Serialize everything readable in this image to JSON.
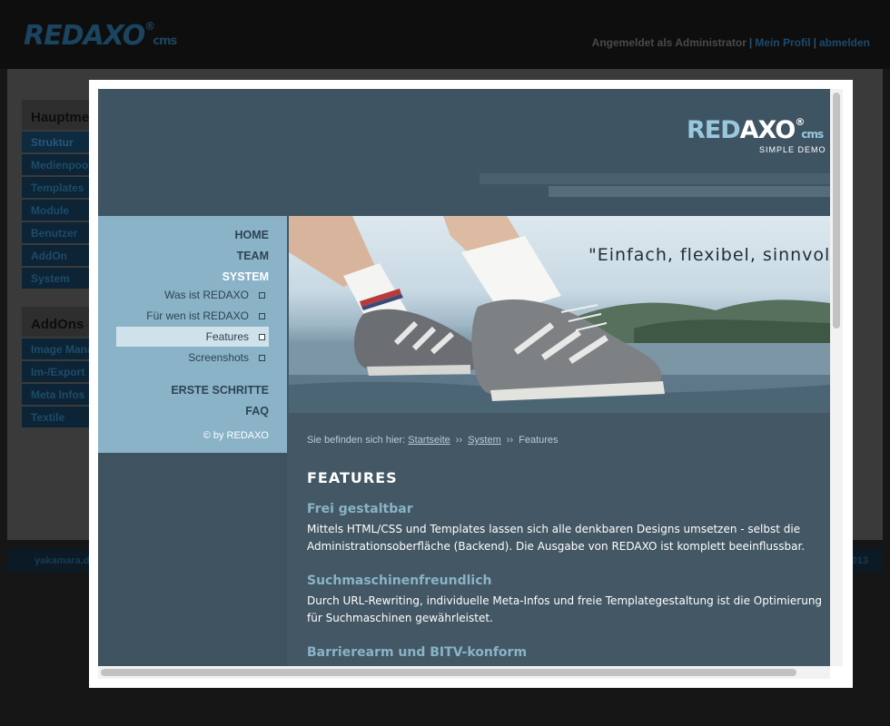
{
  "backend": {
    "logo": {
      "text": "REDAXO",
      "registered": "®",
      "suffix": "cms"
    },
    "login": {
      "text": "Angemeldet als Administrator",
      "profile_link": "Mein Profil",
      "logout_link": "abmelden",
      "separator": "|"
    },
    "main_menu": {
      "title": "Hauptme",
      "items": [
        "Struktur",
        "Medienpool",
        "Templates",
        "Module",
        "Benutzer",
        "AddOn",
        "System"
      ]
    },
    "addons_menu": {
      "title": "AddOns",
      "items": [
        "Image Mana",
        "Im-/Export",
        "Meta Infos",
        "Textile"
      ]
    },
    "footer": {
      "left": "yakamara.d",
      "right": "013"
    }
  },
  "site": {
    "logo": {
      "part1": "RED",
      "part2": "AXO",
      "registered": "®",
      "suffix": "cms"
    },
    "tagline": "SIMPLE DEMO",
    "hero_quote": "\"Einfach, flexibel, sinnvol",
    "nav": {
      "main": [
        "HOME",
        "TEAM",
        "SYSTEM"
      ],
      "sub": [
        "Was ist REDAXO",
        "Für wen ist REDAXO",
        "Features",
        "Screenshots"
      ],
      "extra": [
        "ERSTE SCHRITTE",
        "FAQ"
      ],
      "copyright": "© by REDAXO"
    },
    "breadcrumb": {
      "prefix": "Sie befinden sich hier:",
      "items": [
        "Startseite",
        "System",
        "Features"
      ],
      "separator": "››"
    },
    "page_title": "FEATURES",
    "sections": [
      {
        "title": "Frei gestaltbar",
        "text": "Mittels HTML/CSS und Templates lassen sich alle denkbaren Designs umsetzen - selbst die Administrationsoberfläche (Backend). Die Ausgabe von REDAXO ist komplett beeinflussbar."
      },
      {
        "title": "Suchmaschinenfreundlich",
        "text": "Durch URL-Rewriting, individuelle Meta-Infos und freie Templategestaltung ist die Optimierung für Suchmaschinen gewährleistet."
      },
      {
        "title": "Barrierearm und BITV-konform",
        "text": ""
      }
    ]
  }
}
